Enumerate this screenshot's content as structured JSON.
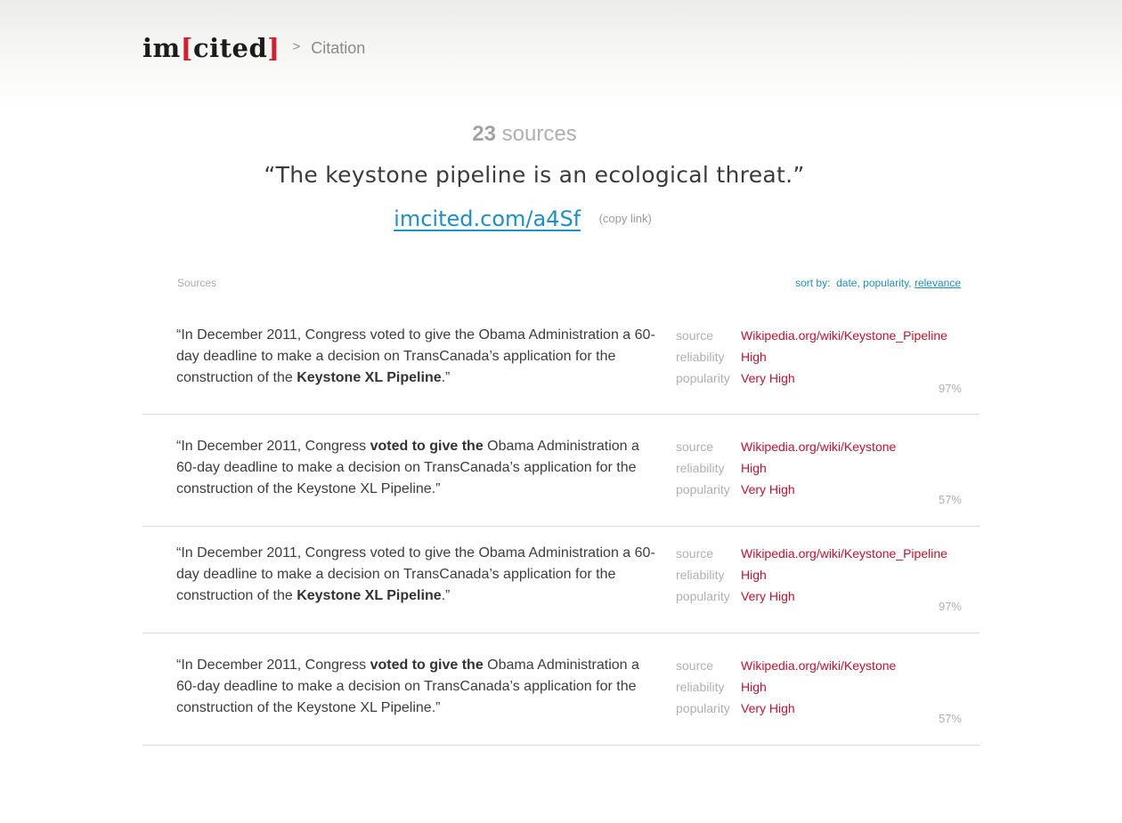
{
  "app": {
    "logo_left": "im",
    "logo_bracket_open": "[",
    "logo_center": "cited",
    "logo_bracket_close": "]",
    "breadcrumb_separator": ">",
    "breadcrumb_page": "Citation",
    "brand_color": "#d3202f",
    "link_color": "#1d8fc9"
  },
  "summary": {
    "count": "23",
    "count_label": "sources",
    "quote": "“The keystone pipeline is an ecological threat.”",
    "short_link": "imcited.com/a4Sf",
    "copy_link_label": "(copy link)"
  },
  "list": {
    "title": "Sources",
    "sort_label": "sort by:",
    "sort_options": [
      "date",
      "popularity",
      "relevance"
    ],
    "sort_active": "relevance"
  },
  "meta_labels": {
    "source": "source",
    "reliability": "reliability",
    "popularity": "popularity"
  },
  "sources": [
    {
      "quote_before": "“In December 2011, Congress voted to give the Obama Administration a 60-day deadline to make a decision on TransCanada’s application for the construction of the ",
      "quote_bold": "Keystone XL Pipeline",
      "quote_after": ".”",
      "source": "Wikipedia.org/wiki/Keystone_Pipeline",
      "reliability": "High",
      "popularity": "Very High",
      "percent": "97%"
    },
    {
      "quote_before": "“In December 2011, Congress ",
      "quote_bold": "voted to give the",
      "quote_after": " Obama Administration a 60-day deadline to make a decision on TransCanada’s application for the construction of the Keystone XL Pipeline.”",
      "source": "Wikipedia.org/wiki/Keystone",
      "reliability": "High",
      "popularity": "Very High",
      "percent": "57%"
    },
    {
      "quote_before": "“In December 2011, Congress voted to give the Obama Administration a 60-day deadline to make a decision on TransCanada’s application for the construction of the ",
      "quote_bold": "Keystone XL Pipeline",
      "quote_after": ".”",
      "source": "Wikipedia.org/wiki/Keystone_Pipeline",
      "reliability": "High",
      "popularity": "Very High",
      "percent": "97%"
    },
    {
      "quote_before": "“In December 2011, Congress ",
      "quote_bold": "voted to give the",
      "quote_after": " Obama Administration a 60-day deadline to make a decision on TransCanada’s application for the construction of the Keystone XL Pipeline.”",
      "source": "Wikipedia.org/wiki/Keystone",
      "reliability": "High",
      "popularity": "Very High",
      "percent": "57%"
    }
  ]
}
